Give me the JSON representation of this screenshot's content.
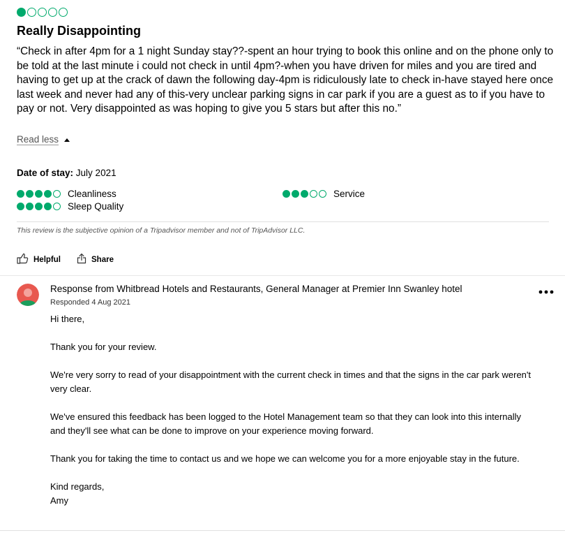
{
  "review": {
    "overall_rating": 1,
    "title": "Really Disappointing",
    "text": "“Check in after 4pm for a 1 night Sunday stay??-spent an hour trying to book this online and on the phone only to be told at the last minute i could not check in until 4pm?-when you have driven for miles and you are tired and having to get up at the crack of dawn the following day-4pm is ridiculously late to check in-have stayed here once last week and never had any of this-very unclear parking signs in car park if you are a guest as to if you have to pay or not. Very disappointed as was hoping to give you 5 stars but after this no.”",
    "read_less_label": "Read less",
    "date_of_stay_label": "Date of stay:",
    "date_of_stay_value": "July 2021",
    "sub_ratings": {
      "cleanliness": {
        "label": "Cleanliness",
        "rating": 4
      },
      "sleep_quality": {
        "label": "Sleep Quality",
        "rating": 4
      },
      "service": {
        "label": "Service",
        "rating": 3
      }
    },
    "disclaimer": "This review is the subjective opinion of a Tripadvisor member and not of TripAdvisor LLC.",
    "actions": {
      "helpful": "Helpful",
      "share": "Share"
    }
  },
  "response": {
    "heading": "Response from Whitbread Hotels and Restaurants, General Manager at Premier Inn Swanley hotel",
    "responded_date": "Responded 4 Aug 2021",
    "paragraphs": [
      "Hi there,",
      "Thank you for your review.",
      "We're very sorry to read of your disappointment with the current check in times and that the signs in the car park weren't very clear.",
      "We've ensured this feedback has been logged to the Hotel Management team so that they can look into this internally and they'll see what can be done to improve on your experience moving forward.",
      "Thank you for taking the time to contact us and we hope we can welcome you for a more enjoyable stay in the future.",
      "Kind regards,\nAmy"
    ]
  },
  "colors": {
    "rating_green": "#00aa6c",
    "avatar_red": "#e8584f",
    "avatar_green": "#1a9e5c"
  },
  "icons": {
    "helpful": "thumbs-up-icon",
    "share": "share-icon",
    "more": "more-options-icon",
    "read_less": "caret-up-icon"
  }
}
